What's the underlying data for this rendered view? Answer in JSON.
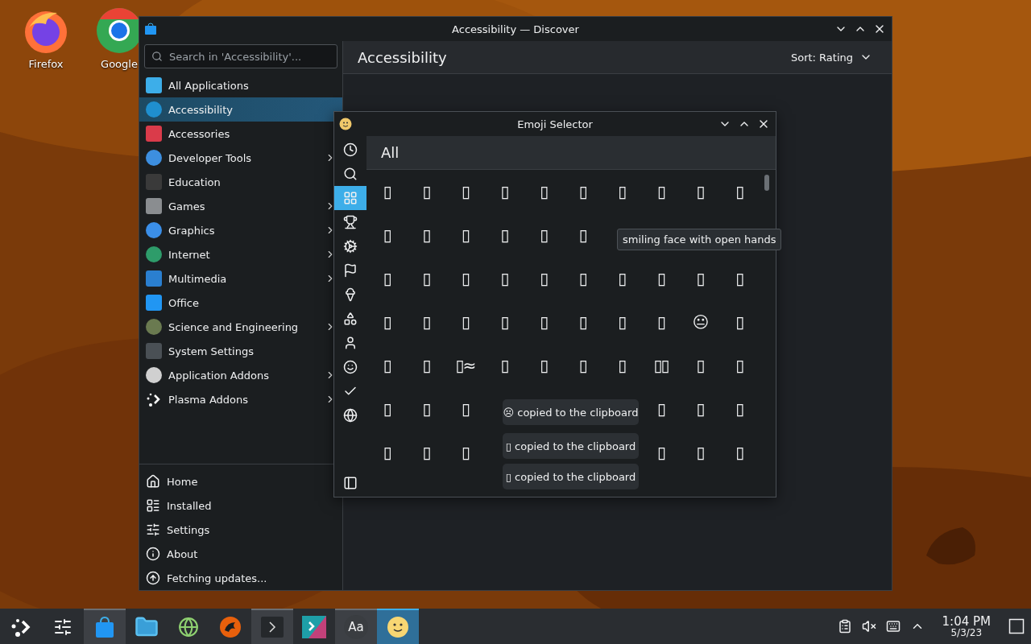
{
  "desktop": {
    "icons": [
      {
        "label": "Firefox",
        "kind": "firefox"
      },
      {
        "label": "Google",
        "kind": "chrome"
      }
    ]
  },
  "discover": {
    "title": "Accessibility — Discover",
    "search": {
      "placeholder": "Search in 'Accessibility'..."
    },
    "categories": [
      {
        "label": "All Applications",
        "selected": false,
        "submenu": false
      },
      {
        "label": "Accessibility",
        "selected": true,
        "submenu": false
      },
      {
        "label": "Accessories",
        "selected": false,
        "submenu": false
      },
      {
        "label": "Developer Tools",
        "selected": false,
        "submenu": true
      },
      {
        "label": "Education",
        "selected": false,
        "submenu": false
      },
      {
        "label": "Games",
        "selected": false,
        "submenu": true
      },
      {
        "label": "Graphics",
        "selected": false,
        "submenu": true
      },
      {
        "label": "Internet",
        "selected": false,
        "submenu": true
      },
      {
        "label": "Multimedia",
        "selected": false,
        "submenu": true
      },
      {
        "label": "Office",
        "selected": false,
        "submenu": false
      },
      {
        "label": "Science and Engineering",
        "selected": false,
        "submenu": true
      },
      {
        "label": "System Settings",
        "selected": false,
        "submenu": false
      },
      {
        "label": "Application Addons",
        "selected": false,
        "submenu": true
      },
      {
        "label": "Plasma Addons",
        "selected": false,
        "submenu": true
      }
    ],
    "nav": [
      {
        "label": "Home"
      },
      {
        "label": "Installed"
      },
      {
        "label": "Settings"
      },
      {
        "label": "About"
      },
      {
        "label": "Fetching updates..."
      }
    ],
    "page_title": "Accessibility",
    "sort": "Sort: Rating"
  },
  "emoji_selector": {
    "title": "Emoji Selector",
    "heading": "All",
    "rail": [
      {
        "selected": false
      },
      {
        "selected": false
      },
      {
        "selected": true
      },
      {
        "selected": false
      },
      {
        "selected": false
      },
      {
        "selected": false
      },
      {
        "selected": false
      },
      {
        "selected": false
      },
      {
        "selected": false
      },
      {
        "selected": false
      },
      {
        "selected": false
      },
      {
        "selected": false
      }
    ],
    "grid": [
      {
        "left": [
          "▯",
          "▯",
          "▯",
          "▯",
          "▯",
          "▯",
          "▯",
          "▯",
          "▯",
          "▯"
        ]
      },
      {
        "left": [
          "▯",
          "▯",
          "▯",
          "▯",
          "▯",
          "▯"
        ]
      },
      {
        "left": [
          "▯",
          "▯",
          "▯",
          "▯",
          "▯",
          "▯",
          "▯",
          "▯",
          "▯",
          "▯"
        ]
      },
      {
        "left": [
          "▯",
          "▯",
          "▯",
          "▯",
          "▯",
          "▯",
          "▯",
          "▯",
          "😐",
          "▯"
        ]
      },
      {
        "left": [
          "▯",
          "▯",
          "▯≈",
          "▯",
          "▯",
          "▯",
          "▯",
          "▯▯",
          "▯",
          "▯"
        ]
      },
      {
        "left": [
          "▯",
          "▯",
          "▯"
        ],
        "right": [
          "▯",
          "▯",
          "▯"
        ]
      },
      {
        "left": [
          "▯",
          "▯",
          "▯"
        ],
        "right": [
          "▯",
          "▯",
          "▯"
        ]
      }
    ],
    "tooltip": "smiling face with open hands",
    "notifications": [
      "☹ copied to the clipboard",
      "▯ copied to the clipboard",
      "▯ copied to the clipboard"
    ]
  },
  "taskbar": {
    "items": [
      {
        "open": false,
        "selected": false
      },
      {
        "open": false,
        "selected": false
      },
      {
        "open": true,
        "selected": false
      },
      {
        "open": false,
        "selected": false
      },
      {
        "open": false,
        "selected": false
      },
      {
        "open": false,
        "selected": false
      },
      {
        "open": true,
        "selected": false
      },
      {
        "open": false,
        "selected": false
      },
      {
        "open": true,
        "selected": false,
        "label": "Aa"
      },
      {
        "open": true,
        "selected": true
      }
    ],
    "time": "1:04 PM",
    "date": "5/3/23"
  }
}
